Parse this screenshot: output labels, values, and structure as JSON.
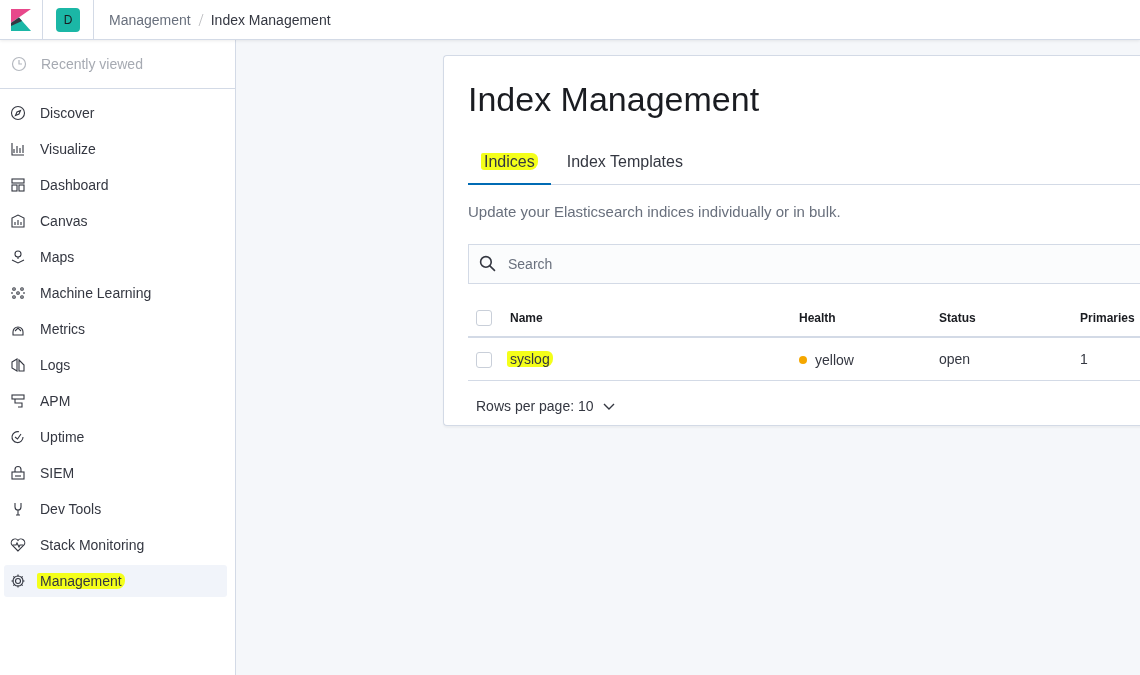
{
  "header": {
    "avatar": "D",
    "breadcrumbs": [
      {
        "label": "Management",
        "current": false
      },
      {
        "label": "Index Management",
        "current": true
      }
    ]
  },
  "sidebar": {
    "recent": "Recently viewed",
    "items": [
      {
        "label": "Discover",
        "selected": false,
        "highlighted": false
      },
      {
        "label": "Visualize",
        "selected": false,
        "highlighted": false
      },
      {
        "label": "Dashboard",
        "selected": false,
        "highlighted": false
      },
      {
        "label": "Canvas",
        "selected": false,
        "highlighted": false
      },
      {
        "label": "Maps",
        "selected": false,
        "highlighted": false
      },
      {
        "label": "Machine Learning",
        "selected": false,
        "highlighted": false
      },
      {
        "label": "Metrics",
        "selected": false,
        "highlighted": false
      },
      {
        "label": "Logs",
        "selected": false,
        "highlighted": false
      },
      {
        "label": "APM",
        "selected": false,
        "highlighted": false
      },
      {
        "label": "Uptime",
        "selected": false,
        "highlighted": false
      },
      {
        "label": "SIEM",
        "selected": false,
        "highlighted": false
      },
      {
        "label": "Dev Tools",
        "selected": false,
        "highlighted": false
      },
      {
        "label": "Stack Monitoring",
        "selected": false,
        "highlighted": false
      },
      {
        "label": "Management",
        "selected": true,
        "highlighted": true
      }
    ]
  },
  "page": {
    "title": "Index Management",
    "tabs": [
      {
        "label": "Indices",
        "selected": true,
        "highlighted": true
      },
      {
        "label": "Index Templates",
        "selected": false,
        "highlighted": false
      }
    ],
    "description": "Update your Elasticsearch indices individually or in bulk.",
    "search": {
      "placeholder": "Search"
    },
    "table": {
      "columns": [
        "Name",
        "Health",
        "Status",
        "Primaries"
      ],
      "select_all_checked": false,
      "rows": [
        {
          "name": "syslog",
          "highlighted": true,
          "checked": false,
          "health": "yellow",
          "color": "#f5a700",
          "status": "open",
          "primaries": "1"
        }
      ]
    },
    "pagination": "Rows per page: 10"
  }
}
